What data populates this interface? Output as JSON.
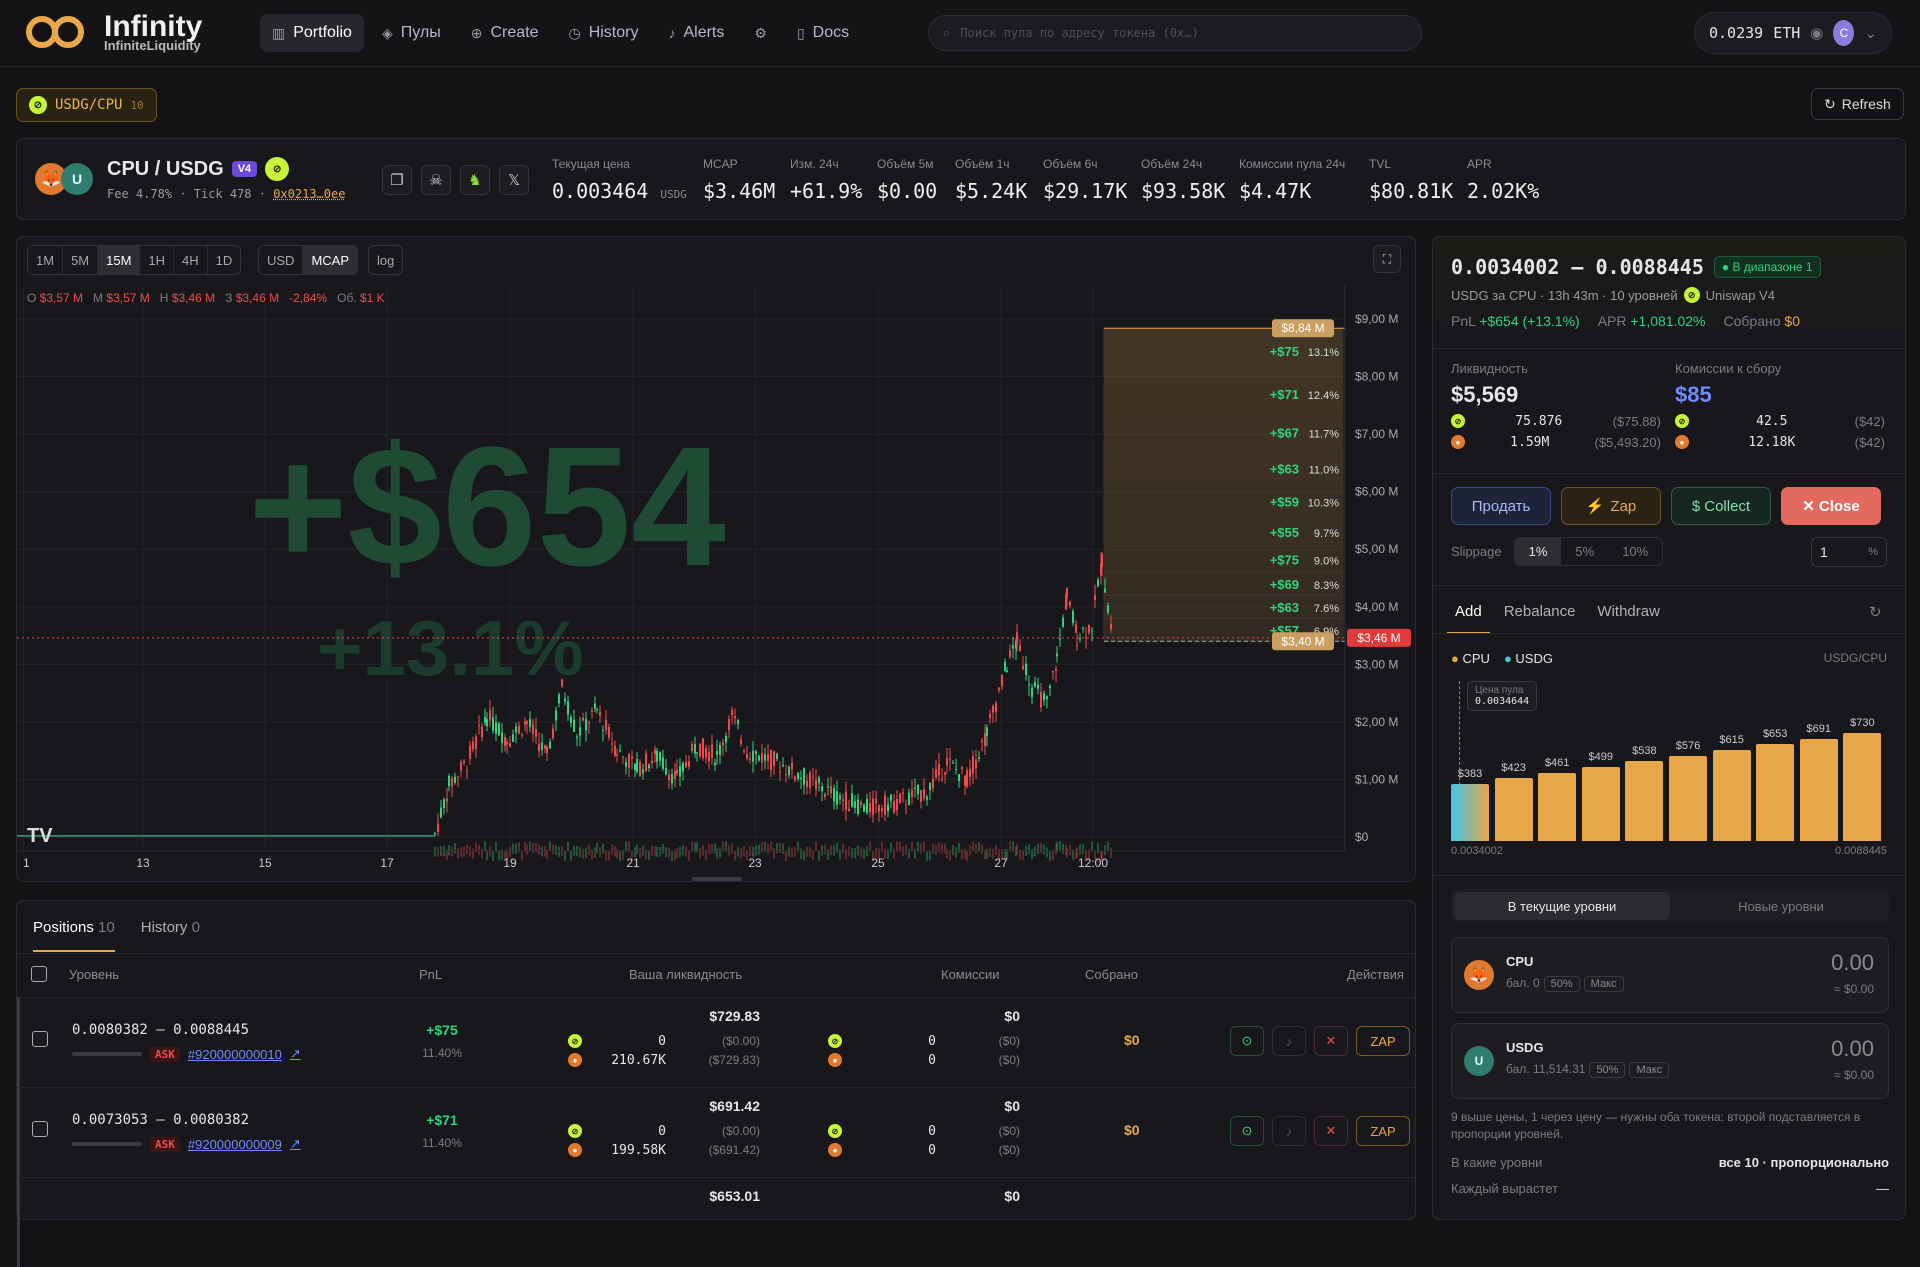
{
  "brand": {
    "title": "Infinity",
    "subtitle": "InfiniteLiquidity",
    "accent": "#e8a84a"
  },
  "nav": [
    {
      "label": "Portfolio",
      "icon": "bar-chart-icon",
      "active": true
    },
    {
      "label": "Пулы",
      "icon": "layers-icon"
    },
    {
      "label": "Create",
      "icon": "plus-circle-icon"
    },
    {
      "label": "History",
      "icon": "clock-icon"
    },
    {
      "label": "Alerts",
      "icon": "bell-icon"
    },
    {
      "label": "",
      "icon": "gear-icon"
    },
    {
      "label": "Docs",
      "icon": "book-icon"
    }
  ],
  "search": {
    "placeholder": "Поиск пула по адресу токена (0x…)"
  },
  "wallet": {
    "balance": "0.0239",
    "unit": "ETH",
    "avatar": "C"
  },
  "pair_chip": {
    "label": "USDG/CPU",
    "count": "10"
  },
  "refresh_label": "Refresh",
  "pool": {
    "name": "CPU / USDG",
    "version": "V4",
    "fee": "Fee 4.78%",
    "tick": "Tick 478",
    "address": "0x0213…0ee",
    "stats": [
      {
        "label": "Текущая цена",
        "value": "0.003464",
        "unit": "USDG"
      },
      {
        "label": "MCAP",
        "value": "$3.46M"
      },
      {
        "label": "Изм. 24ч",
        "value": "+61.9%",
        "color": "green"
      },
      {
        "label": "Объём 5м",
        "value": "$0.00"
      },
      {
        "label": "Объём 1ч",
        "value": "$5.24K"
      },
      {
        "label": "Объём 6ч",
        "value": "$29.17K"
      },
      {
        "label": "Объём 24ч",
        "value": "$93.58K"
      },
      {
        "label": "Комиссии пула 24ч",
        "value": "$4.47K"
      },
      {
        "label": "TVL",
        "value": "$80.81K"
      },
      {
        "label": "APR",
        "value": "2.02K%",
        "color": "green"
      }
    ]
  },
  "chart": {
    "timeframes": [
      "1M",
      "5M",
      "15M",
      "1H",
      "4H",
      "1D"
    ],
    "selected_tf": "15M",
    "modes": [
      "USD",
      "MCAP"
    ],
    "selected_mode": "MCAP",
    "log": "log",
    "ohlc": {
      "o": "$3,57 M",
      "h_label": "М",
      "h": "$3,57 M",
      "l_label": "Н",
      "l": "$3,46 M",
      "c_label": "З",
      "c": "$3,46 M",
      "chg": "-2,84%",
      "vol_label": "Об.",
      "vol": "$1 K"
    },
    "watermark_pnl": "+$654",
    "watermark_pct": "+13.1%",
    "y_ticks": [
      "$9,00 M",
      "$8,00 M",
      "$7,00 M",
      "$6,00 M",
      "$5,00 M",
      "$4,00 M",
      "$3,00 M",
      "$2,00 M",
      "$1,00 M",
      "$0"
    ],
    "x_ticks": [
      "1",
      "13",
      "15",
      "17",
      "19",
      "21",
      "23",
      "25",
      "27",
      "12:00"
    ],
    "top_tag": "$8,84 M",
    "current_tag": "$3,46 M",
    "bottom_tag": "$3,40 M",
    "levels": [
      {
        "pnl": "+$75",
        "pct": "13.1%"
      },
      {
        "pnl": "+$71",
        "pct": "12.4%"
      },
      {
        "pnl": "+$67",
        "pct": "11.7%"
      },
      {
        "pnl": "+$63",
        "pct": "11.0%"
      },
      {
        "pnl": "+$59",
        "pct": "10.3%"
      },
      {
        "pnl": "+$55",
        "pct": "9.7%"
      },
      {
        "pnl": "+$75",
        "pct": "9.0%"
      },
      {
        "pnl": "+$69",
        "pct": "8.3%"
      },
      {
        "pnl": "+$63",
        "pct": "7.6%"
      },
      {
        "pnl": "+$57",
        "pct": "6.9%"
      }
    ]
  },
  "positions": {
    "tabs": [
      {
        "label": "Positions",
        "count": "10"
      },
      {
        "label": "History",
        "count": "0"
      }
    ],
    "headers": {
      "level": "Уровень",
      "pnl": "PnL",
      "liq": "Ваша ликвидность",
      "fees": "Комиссии",
      "collected": "Собрано",
      "actions": "Действия"
    },
    "rows": [
      {
        "range": "0.0080382 — 0.0088445",
        "side": "ASK",
        "id": "#920000000010",
        "pnl": "+$75",
        "pct": "11.40%",
        "liq": "$729.83",
        "a1": "0",
        "a1u": "($0.00)",
        "a2": "210.67K",
        "a2u": "($729.83)",
        "fee": "$0",
        "f1": "0",
        "f1u": "($0)",
        "f2": "0",
        "f2u": "($0)",
        "collected": "$0",
        "zap": "ZAP"
      },
      {
        "range": "0.0073053 — 0.0080382",
        "side": "ASK",
        "id": "#920000000009",
        "pnl": "+$71",
        "pct": "11.40%",
        "liq": "$691.42",
        "a1": "0",
        "a1u": "($0.00)",
        "a2": "199.58K",
        "a2u": "($691.42)",
        "fee": "$0",
        "f1": "0",
        "f1u": "($0)",
        "f2": "0",
        "f2u": "($0)",
        "collected": "$0",
        "zap": "ZAP"
      },
      {
        "liq": "$653.01",
        "fee": "$0"
      }
    ]
  },
  "side": {
    "range": "0.0034002 – 0.0088445",
    "status": "В диапазоне 1",
    "subtitle": "USDG за CPU · 13h 43m · 10 уровней",
    "dex": "Uniswap V4",
    "pnl_label": "PnL",
    "pnl": "+$654 (+13.1%)",
    "apr_label": "APR",
    "apr": "+1,081.02%",
    "col_label": "Собрано",
    "col": "$0",
    "liq_label": "Ликвидность",
    "liq": "$5,569",
    "liq_a": "75.876",
    "liq_au": "($75.88)",
    "liq_b": "1.59M",
    "liq_bu": "($5,493.20)",
    "fee_label": "Комиссии к сбору",
    "fee": "$85",
    "fee_a": "42.5",
    "fee_au": "($42)",
    "fee_b": "12.18K",
    "fee_bu": "($42)",
    "buttons": {
      "sell": "Продать",
      "zap": "Zap",
      "collect": "Collect",
      "close": "Close"
    },
    "slippage_label": "Slippage",
    "slippage": [
      "1%",
      "5%",
      "10%"
    ],
    "slippage_value": "1",
    "slippage_unit": "%",
    "tabs": [
      "Add",
      "Rebalance",
      "Withdraw"
    ],
    "legend": [
      "CPU",
      "USDG"
    ],
    "pair": "USDG/CPU",
    "pool_price_label": "Цена пула",
    "pool_price": "0.0034644",
    "bars": [
      "$383",
      "$423",
      "$461",
      "$499",
      "$538",
      "$576",
      "$615",
      "$653",
      "$691",
      "$730"
    ],
    "bar_min": "0.0034002",
    "bar_max": "0.0088445",
    "level_tabs": [
      "В текущие уровни",
      "Новые уровни"
    ],
    "in_cpu": {
      "sym": "CPU",
      "bal": "бал. 0",
      "value": "0.00",
      "usd": "≈ $0.00"
    },
    "in_usdg": {
      "sym": "USDG",
      "bal": "бал. 11,514.31",
      "value": "0.00",
      "usd": "≈ $0.00"
    },
    "pct_pills": [
      "50%",
      "Макс"
    ],
    "note": "9 выше цены, 1 через цену — нужны оба токена: второй подставляется в пропорции уровней.",
    "which_label": "В какие уровни",
    "which_value": "все 10 · пропорционально",
    "each_label": "Каждый вырастет",
    "each_value": "—"
  }
}
